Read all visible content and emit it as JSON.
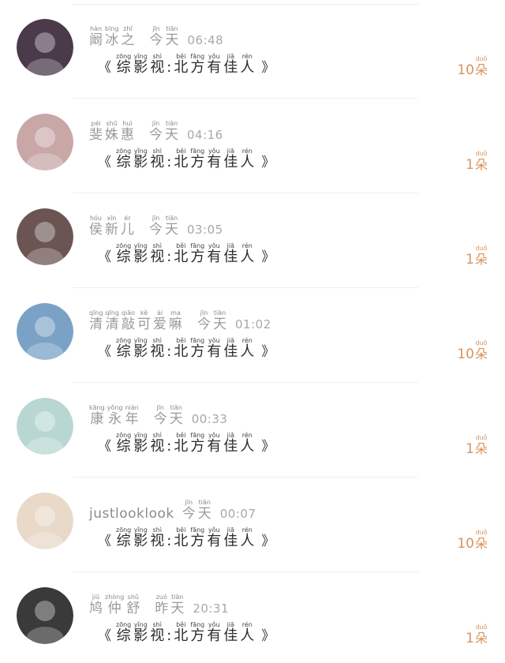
{
  "rows": [
    {
      "name": [
        {
          "py": "hàn",
          "hz": "阚"
        },
        {
          "py": "bīng",
          "hz": "冰"
        },
        {
          "py": "zhī",
          "hz": "之"
        }
      ],
      "day": [
        {
          "py": "jīn",
          "hz": "今"
        },
        {
          "py": "tiān",
          "hz": "天"
        }
      ],
      "time": "06:48",
      "title": [
        {
          "py": "zōng",
          "hz": "综"
        },
        {
          "py": "yǐng",
          "hz": "影"
        },
        {
          "py": "shì",
          "hz": "视"
        },
        {
          "py": "",
          "hz": ":"
        },
        {
          "py": "běi",
          "hz": "北"
        },
        {
          "py": "fāng",
          "hz": "方"
        },
        {
          "py": "yǒu",
          "hz": "有"
        },
        {
          "py": "jiā",
          "hz": "佳"
        },
        {
          "py": "rén",
          "hz": "人"
        }
      ],
      "count": "10",
      "unit": {
        "py": "duǒ",
        "hz": "朵"
      },
      "avatar_color": "#4a3a4a"
    },
    {
      "name": [
        {
          "py": "péi",
          "hz": "斐"
        },
        {
          "py": "shū",
          "hz": "姝"
        },
        {
          "py": "huì",
          "hz": "惠"
        }
      ],
      "day": [
        {
          "py": "jīn",
          "hz": "今"
        },
        {
          "py": "tiān",
          "hz": "天"
        }
      ],
      "time": "04:16",
      "title": [
        {
          "py": "zōng",
          "hz": "综"
        },
        {
          "py": "yǐng",
          "hz": "影"
        },
        {
          "py": "shì",
          "hz": "视"
        },
        {
          "py": "",
          "hz": ":"
        },
        {
          "py": "běi",
          "hz": "北"
        },
        {
          "py": "fāng",
          "hz": "方"
        },
        {
          "py": "yǒu",
          "hz": "有"
        },
        {
          "py": "jiā",
          "hz": "佳"
        },
        {
          "py": "rén",
          "hz": "人"
        }
      ],
      "count": "1",
      "unit": {
        "py": "duǒ",
        "hz": "朵"
      },
      "avatar_color": "#c9a7a7"
    },
    {
      "name": [
        {
          "py": "hóu",
          "hz": "侯"
        },
        {
          "py": "xīn",
          "hz": "新"
        },
        {
          "py": "ér",
          "hz": "儿"
        }
      ],
      "day": [
        {
          "py": "jīn",
          "hz": "今"
        },
        {
          "py": "tiān",
          "hz": "天"
        }
      ],
      "time": "03:05",
      "title": [
        {
          "py": "zōng",
          "hz": "综"
        },
        {
          "py": "yǐng",
          "hz": "影"
        },
        {
          "py": "shì",
          "hz": "视"
        },
        {
          "py": "",
          "hz": ":"
        },
        {
          "py": "běi",
          "hz": "北"
        },
        {
          "py": "fāng",
          "hz": "方"
        },
        {
          "py": "yǒu",
          "hz": "有"
        },
        {
          "py": "jiā",
          "hz": "佳"
        },
        {
          "py": "rén",
          "hz": "人"
        }
      ],
      "count": "1",
      "unit": {
        "py": "duǒ",
        "hz": "朵"
      },
      "avatar_color": "#6b5552"
    },
    {
      "name": [
        {
          "py": "qīng",
          "hz": "清"
        },
        {
          "py": "qīng",
          "hz": "清"
        },
        {
          "py": "qiāo",
          "hz": "敲"
        },
        {
          "py": "kě",
          "hz": "可"
        },
        {
          "py": "ài",
          "hz": "爱"
        },
        {
          "py": "ma",
          "hz": "嘛"
        }
      ],
      "day": [
        {
          "py": "jīn",
          "hz": "今"
        },
        {
          "py": "tiān",
          "hz": "天"
        }
      ],
      "time": "01:02",
      "title": [
        {
          "py": "zōng",
          "hz": "综"
        },
        {
          "py": "yǐng",
          "hz": "影"
        },
        {
          "py": "shì",
          "hz": "视"
        },
        {
          "py": "",
          "hz": ":"
        },
        {
          "py": "běi",
          "hz": "北"
        },
        {
          "py": "fāng",
          "hz": "方"
        },
        {
          "py": "yǒu",
          "hz": "有"
        },
        {
          "py": "jiā",
          "hz": "佳"
        },
        {
          "py": "rén",
          "hz": "人"
        }
      ],
      "count": "10",
      "unit": {
        "py": "duǒ",
        "hz": "朵"
      },
      "avatar_color": "#7aa2c7"
    },
    {
      "name": [
        {
          "py": "kāng",
          "hz": "康"
        },
        {
          "py": "yǒng",
          "hz": "永"
        },
        {
          "py": "nián",
          "hz": "年"
        }
      ],
      "day": [
        {
          "py": "jīn",
          "hz": "今"
        },
        {
          "py": "tiān",
          "hz": "天"
        }
      ],
      "time": "00:33",
      "title": [
        {
          "py": "zōng",
          "hz": "综"
        },
        {
          "py": "yǐng",
          "hz": "影"
        },
        {
          "py": "shì",
          "hz": "视"
        },
        {
          "py": "",
          "hz": ":"
        },
        {
          "py": "běi",
          "hz": "北"
        },
        {
          "py": "fāng",
          "hz": "方"
        },
        {
          "py": "yǒu",
          "hz": "有"
        },
        {
          "py": "jiā",
          "hz": "佳"
        },
        {
          "py": "rén",
          "hz": "人"
        }
      ],
      "count": "1",
      "unit": {
        "py": "duǒ",
        "hz": "朵"
      },
      "avatar_color": "#b9d7d2"
    },
    {
      "latin_name": "justlooklook",
      "day": [
        {
          "py": "jīn",
          "hz": "今"
        },
        {
          "py": "tiān",
          "hz": "天"
        }
      ],
      "time": "00:07",
      "title": [
        {
          "py": "zōng",
          "hz": "综"
        },
        {
          "py": "yǐng",
          "hz": "影"
        },
        {
          "py": "shì",
          "hz": "视"
        },
        {
          "py": "",
          "hz": ":"
        },
        {
          "py": "běi",
          "hz": "北"
        },
        {
          "py": "fāng",
          "hz": "方"
        },
        {
          "py": "yǒu",
          "hz": "有"
        },
        {
          "py": "jiā",
          "hz": "佳"
        },
        {
          "py": "rén",
          "hz": "人"
        }
      ],
      "count": "10",
      "unit": {
        "py": "duǒ",
        "hz": "朵"
      },
      "avatar_color": "#e8d9c9"
    },
    {
      "name": [
        {
          "py": "jiū",
          "hz": "鸠"
        },
        {
          "py": "zhòng",
          "hz": "仲"
        },
        {
          "py": "shū",
          "hz": "舒"
        }
      ],
      "day": [
        {
          "py": "zuó",
          "hz": "昨"
        },
        {
          "py": "tiān",
          "hz": "天"
        }
      ],
      "time": "20:31",
      "title": [
        {
          "py": "zōng",
          "hz": "综"
        },
        {
          "py": "yǐng",
          "hz": "影"
        },
        {
          "py": "shì",
          "hz": "视"
        },
        {
          "py": "",
          "hz": ":"
        },
        {
          "py": "běi",
          "hz": "北"
        },
        {
          "py": "fāng",
          "hz": "方"
        },
        {
          "py": "yǒu",
          "hz": "有"
        },
        {
          "py": "jiā",
          "hz": "佳"
        },
        {
          "py": "rén",
          "hz": "人"
        }
      ],
      "count": "1",
      "unit": {
        "py": "duǒ",
        "hz": "朵"
      },
      "avatar_color": "#3a3a3a"
    }
  ],
  "open_quote": "《",
  "close_quote": "》"
}
